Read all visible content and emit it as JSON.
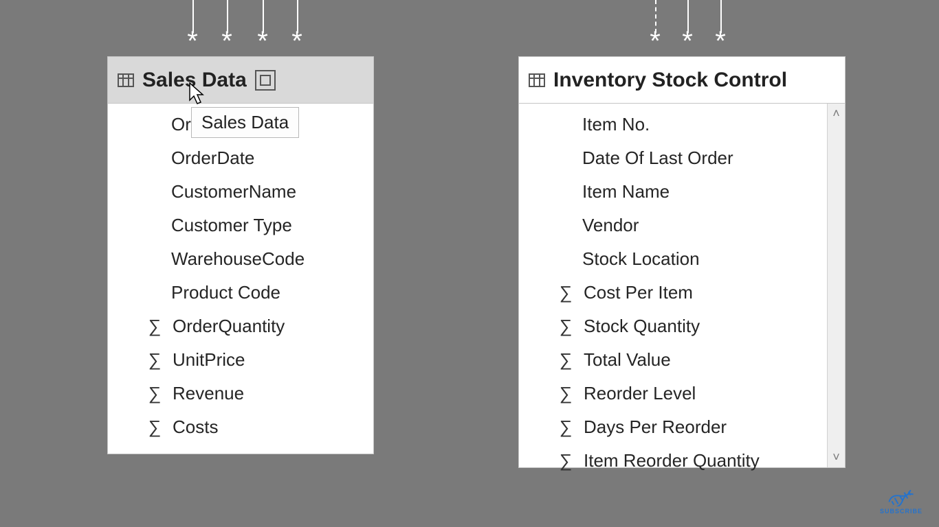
{
  "connectors": {
    "left": {
      "lines": [
        280,
        330,
        382,
        432
      ],
      "dashed_index": null,
      "stars": [
        280,
        330,
        382,
        432
      ]
    },
    "right": {
      "lines": [
        953,
        1000,
        1048
      ],
      "dashed_index": 0,
      "stars": [
        953,
        1000,
        1048
      ]
    }
  },
  "tooltip": {
    "text": "Sales Data"
  },
  "tables": {
    "left": {
      "title": "Sales Data",
      "selected": true,
      "show_mode_icon": true,
      "fields": [
        {
          "label": "Order ID",
          "numeric": false
        },
        {
          "label": "OrderDate",
          "numeric": false
        },
        {
          "label": "CustomerName",
          "numeric": false
        },
        {
          "label": "Customer Type",
          "numeric": false
        },
        {
          "label": "WarehouseCode",
          "numeric": false
        },
        {
          "label": "Product Code",
          "numeric": false
        },
        {
          "label": "OrderQuantity",
          "numeric": true
        },
        {
          "label": "UnitPrice",
          "numeric": true
        },
        {
          "label": "Revenue",
          "numeric": true
        },
        {
          "label": "Costs",
          "numeric": true
        }
      ]
    },
    "right": {
      "title": "Inventory Stock Control",
      "selected": false,
      "show_mode_icon": false,
      "has_scrollbar": true,
      "fields": [
        {
          "label": "Item No.",
          "numeric": false
        },
        {
          "label": "Date Of Last Order",
          "numeric": false
        },
        {
          "label": "Item Name",
          "numeric": false
        },
        {
          "label": "Vendor",
          "numeric": false
        },
        {
          "label": "Stock Location",
          "numeric": false
        },
        {
          "label": "Cost Per Item",
          "numeric": true
        },
        {
          "label": "Stock Quantity",
          "numeric": true
        },
        {
          "label": "Total Value",
          "numeric": true
        },
        {
          "label": "Reorder Level",
          "numeric": true
        },
        {
          "label": "Days Per Reorder",
          "numeric": true
        },
        {
          "label": "Item Reorder Quantity",
          "numeric": true
        }
      ]
    }
  },
  "watermark": {
    "label": "SUBSCRIBE"
  }
}
